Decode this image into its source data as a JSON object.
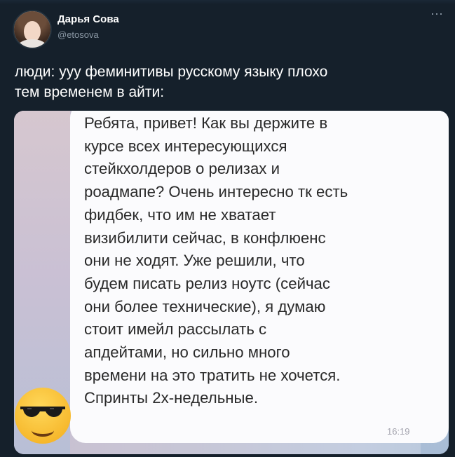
{
  "tweet": {
    "author_name": "Дарья Сова",
    "author_handle": "@etosova",
    "more_icon": "more-horizontal-icon",
    "text_lines": [
      "люди: ууу феминитивы русскому языку плохо",
      "тем временем в айти:"
    ]
  },
  "image": {
    "message_lines": [
      "Ребята, привет! Как вы держите в",
      "курсе всех интересующихся",
      "стейкхолдеров о релизах и",
      "роадмапе? Очень интересно тк есть",
      "фидбек, что им не хватает",
      "визибилити сейчас, в конфлюенс",
      "они не ходят. Уже решили, что",
      "будем писать релиз ноутс (сейчас",
      "они более технические), я думаю",
      "стоит имейл рассылать с",
      "апдейтами, но сильно много",
      "времени на это тратить не хочется.",
      "Спринты 2х-недельные."
    ],
    "time": "16:19",
    "emoji": "sunglasses-emoji-icon"
  },
  "colors": {
    "background": "#15202b",
    "secondary_text": "#8b98a5"
  }
}
